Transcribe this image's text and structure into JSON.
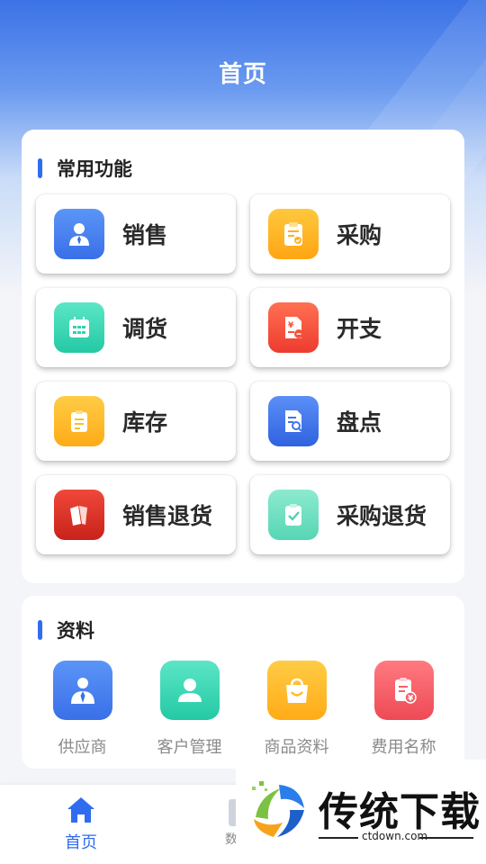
{
  "header": {
    "title": "首页"
  },
  "common": {
    "title": "常用功能",
    "items": [
      {
        "label": "销售",
        "icon": "salesperson-icon",
        "color": "#3f7ef2"
      },
      {
        "label": "采购",
        "icon": "clipboard-check-icon",
        "color": "#ffb21f"
      },
      {
        "label": "调货",
        "icon": "calendar-icon",
        "color": "#2fd3b0"
      },
      {
        "label": "开支",
        "icon": "expense-receipt-icon",
        "color": "#f5523c"
      },
      {
        "label": "库存",
        "icon": "notepad-icon",
        "color": "#ffbf24"
      },
      {
        "label": "盘点",
        "icon": "document-search-icon",
        "color": "#3f74ee"
      },
      {
        "label": "销售退货",
        "icon": "return-tag-icon",
        "color": "#e2352a"
      },
      {
        "label": "采购退货",
        "icon": "clipboard-tick-icon",
        "color": "#6fe0c3"
      }
    ]
  },
  "data": {
    "title": "资料",
    "items": [
      {
        "label": "供应商",
        "icon": "supplier-icon",
        "color": "#3f7ef2"
      },
      {
        "label": "客户管理",
        "icon": "customer-icon",
        "color": "#2fd3b0"
      },
      {
        "label": "商品资料",
        "icon": "shopping-bag-icon",
        "color": "#ffbb24"
      },
      {
        "label": "费用名称",
        "icon": "fee-document-icon",
        "color": "#f5616a"
      }
    ]
  },
  "nav": {
    "home": {
      "label": "首页",
      "icon": "home-icon"
    },
    "second": {
      "label": "数"
    }
  },
  "watermark": {
    "title": "传统下载",
    "url": "ctdown.com"
  }
}
